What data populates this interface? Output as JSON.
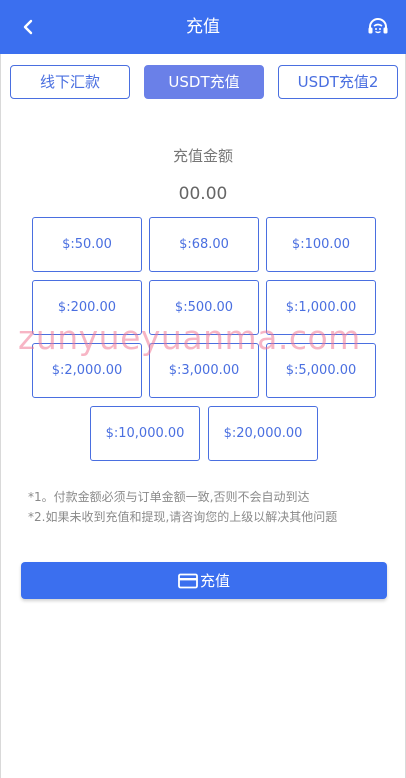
{
  "header": {
    "title": "充值"
  },
  "tabs": [
    {
      "label": "线下汇款",
      "active": false
    },
    {
      "label": "USDT充值",
      "active": true
    },
    {
      "label": "USDT充值2",
      "active": false
    }
  ],
  "amount": {
    "label": "充值金额",
    "value": "00.00"
  },
  "amount_options": [
    "$:50.00",
    "$:68.00",
    "$:100.00",
    "$:200.00",
    "$:500.00",
    "$:1,000.00",
    "$:2,000.00",
    "$:3,000.00",
    "$:5,000.00",
    "$:10,000.00",
    "$:20,000.00"
  ],
  "watermark": "zunyueyuanma.com",
  "notes": [
    "*1。付款金额必须与订单金额一致,否则不会自动到达",
    "*2.如果未收到充值和提现,请咨询您的上级以解决其他问题"
  ],
  "submit": {
    "label": "充值"
  },
  "colors": {
    "primary": "#3b6fef",
    "tab_active": "#6a80e8",
    "border": "#4a6fe0"
  },
  "icons": {
    "back": "chevron-left-icon",
    "support": "headset-icon",
    "submit": "credit-card-icon"
  }
}
